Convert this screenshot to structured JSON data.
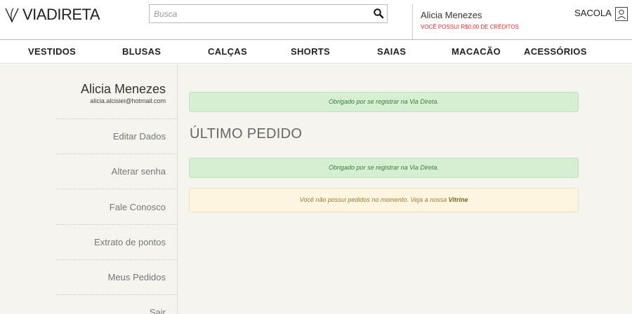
{
  "header": {
    "logo_text": "VIADIRETA",
    "search_placeholder": "Busca",
    "user_name": "Alicia Menezes",
    "credits_text": "VOCÊ POSSUI R$0,00 DE CRÉDITOS",
    "bag_label": "SACOLA"
  },
  "nav": {
    "items": [
      {
        "label": "VESTIDOS"
      },
      {
        "label": "BLUSAS"
      },
      {
        "label": "CALÇAS"
      },
      {
        "label": "SHORTS"
      },
      {
        "label": "SAIAS"
      },
      {
        "label": "MACACÃO"
      },
      {
        "label": "ACESSÓRIOS"
      }
    ]
  },
  "sidebar": {
    "name": "Alicia Menezes",
    "email": "alicia.alcisiei@hotmail.com",
    "items": [
      {
        "label": "Editar Dados"
      },
      {
        "label": "Alterar senha"
      },
      {
        "label": "Fale Conosco"
      },
      {
        "label": "Extrato de pontos"
      },
      {
        "label": "Meus Pedidos"
      },
      {
        "label": "Sair"
      }
    ]
  },
  "main": {
    "alert_top": "Obrigado por se registrar na Via Direta.",
    "heading": "ÚLTIMO PEDIDO",
    "alert_second": "Obrigado por se registrar na Via Direta.",
    "warning_text": "Você não possui pedidos no momento. Veja a nossa",
    "warning_link": "Vitrine"
  },
  "colors": {
    "accent_red": "#e0282e",
    "success_bg": "#d6efd3",
    "warning_bg": "#fcf6e1",
    "content_bg": "#f6f4ef"
  },
  "icons": {
    "logo": "viadireta-logo-icon",
    "search": "search-icon",
    "bag": "bag-icon"
  }
}
